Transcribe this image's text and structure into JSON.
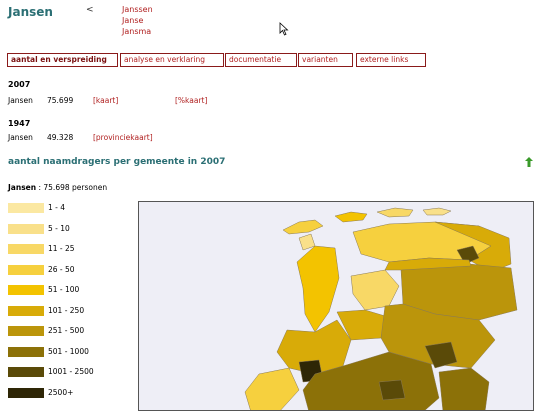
{
  "header": {
    "surname": "Jansen",
    "back_symbol": "<",
    "related_names": [
      "Janssen",
      "Janse",
      "Jansma"
    ]
  },
  "tabs": [
    {
      "label": "aantal en verspreiding",
      "active": true
    },
    {
      "label": "analyse en verklaring",
      "active": false
    },
    {
      "label": "documentatie",
      "active": false
    },
    {
      "label": "varianten",
      "active": false
    },
    {
      "label": "externe links",
      "active": false
    }
  ],
  "years": [
    {
      "year": "2007",
      "name": "Jansen",
      "count": "75.699",
      "link1": "[kaart]",
      "link2": "[%kaart]"
    },
    {
      "year": "1947",
      "name": "Jansen",
      "count": "49.328",
      "link1": "[provinciekaart]",
      "link2": ""
    }
  ],
  "section_title": "aantal naamdragers per gemeente in 2007",
  "summary": {
    "name": "Jansen",
    "rest": " : 75.698 personen"
  },
  "legend": [
    {
      "label": "1 - 4",
      "color": "#fbe8a2"
    },
    {
      "label": "5 - 10",
      "color": "#f9e08a"
    },
    {
      "label": "11 - 25",
      "color": "#f8d866"
    },
    {
      "label": "26 - 50",
      "color": "#f6d03e"
    },
    {
      "label": "51 - 100",
      "color": "#f3c300"
    },
    {
      "label": "101 - 250",
      "color": "#d8ab08"
    },
    {
      "label": "251 - 500",
      "color": "#bb950b"
    },
    {
      "label": "501 - 1000",
      "color": "#8c7108"
    },
    {
      "label": "1001 - 2500",
      "color": "#5a4a08"
    },
    {
      "label": "2500+",
      "color": "#2e2606"
    }
  ],
  "map": {
    "sea_color": "#eeeef6",
    "land_border": "#8a7a55"
  }
}
